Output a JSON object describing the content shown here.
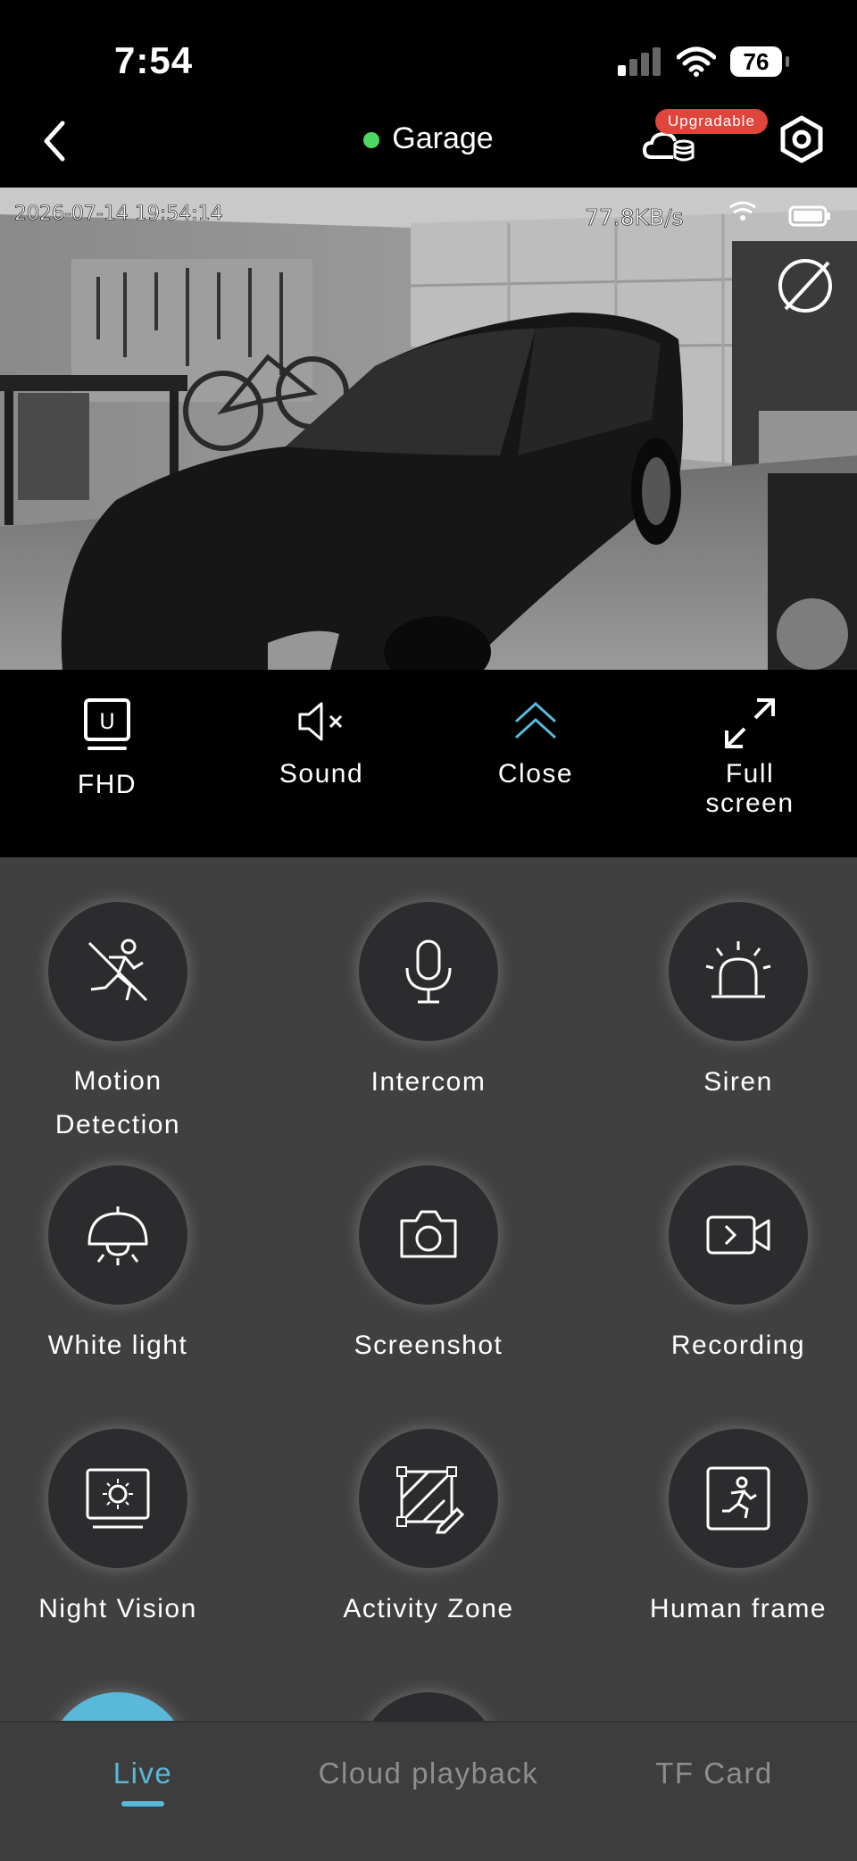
{
  "status_bar": {
    "time": "7:54",
    "battery": "76"
  },
  "header": {
    "title": "Garage",
    "online_color": "#4cd964",
    "upgrade_badge": "Upgradable"
  },
  "video": {
    "timestamp": "2026-07-14 19:54:14",
    "bitrate": "77.8KB/s"
  },
  "controls": [
    {
      "label": "FHD",
      "icon_text": "U",
      "icon": "hd-box-icon"
    },
    {
      "label": "Sound",
      "icon": "speaker-muted-icon"
    },
    {
      "label": "Close",
      "icon": "double-chevron-up-icon"
    },
    {
      "label": "Full\nscreen",
      "icon": "expand-icon"
    }
  ],
  "features": [
    {
      "label": "Motion\nDetection",
      "icon": "motion-detection-icon"
    },
    {
      "label": "Intercom",
      "icon": "microphone-icon"
    },
    {
      "label": "Siren",
      "icon": "siren-icon"
    },
    {
      "label": "White light",
      "icon": "lamp-icon"
    },
    {
      "label": "Screenshot",
      "icon": "camera-icon"
    },
    {
      "label": "Recording",
      "icon": "video-record-icon"
    },
    {
      "label": "Night Vision",
      "icon": "night-vision-icon"
    },
    {
      "label": "Activity Zone",
      "icon": "activity-zone-icon"
    },
    {
      "label": "Human frame",
      "icon": "human-frame-icon"
    }
  ],
  "tabs": [
    {
      "label": "Live",
      "active": true
    },
    {
      "label": "Cloud playback",
      "active": false
    },
    {
      "label": "TF Card",
      "active": false
    }
  ],
  "colors": {
    "accent": "#5ab8d8",
    "badge": "#e0453b",
    "panel": "#404040",
    "circle": "#2c2c2e"
  }
}
